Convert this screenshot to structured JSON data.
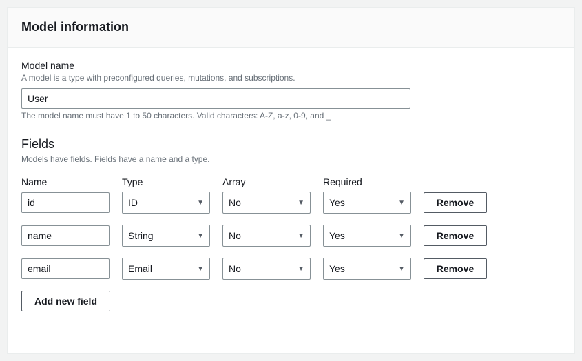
{
  "panel": {
    "title": "Model information"
  },
  "modelName": {
    "label": "Model name",
    "description": "A model is a type with preconfigured queries, mutations, and subscriptions.",
    "value": "User",
    "constraint": "The model name must have 1 to 50 characters. Valid characters: A-Z, a-z, 0-9, and _"
  },
  "fieldsSection": {
    "title": "Fields",
    "description": "Models have fields. Fields have a name and a type."
  },
  "columns": {
    "name": "Name",
    "type": "Type",
    "array": "Array",
    "required": "Required"
  },
  "rows": [
    {
      "name": "id",
      "type": "ID",
      "array": "No",
      "required": "Yes"
    },
    {
      "name": "name",
      "type": "String",
      "array": "No",
      "required": "Yes"
    },
    {
      "name": "email",
      "type": "Email",
      "array": "No",
      "required": "Yes"
    }
  ],
  "buttons": {
    "remove": "Remove",
    "addNewField": "Add new field"
  }
}
